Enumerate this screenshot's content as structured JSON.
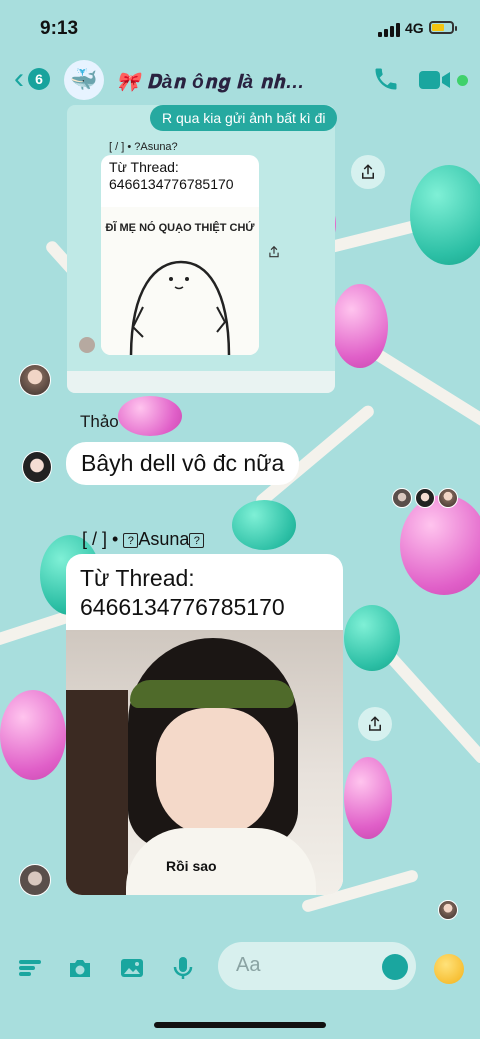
{
  "status": {
    "time": "9:13",
    "network": "4G"
  },
  "header": {
    "back_count": "6",
    "title": "🎀 𝐃à𝐧 ô𝐧𝐠 𝐥à 𝐧𝐡…",
    "group_avatar_icon": "whale-icon"
  },
  "messages": {
    "reply_text": "R qua kia gửi ảnh bất kì đi",
    "screenshot": {
      "meta": "[ / ] • ?Asuna?",
      "thread_label": "Từ Thread:",
      "thread_id": "6466134776785170",
      "meme_caption": "ĐĨ MẸ NÓ QUẠO THIỆT CHỨ"
    },
    "sender_name": "Thảo",
    "text_message": "Bâyh dell vô đc nữa",
    "post": {
      "meta_prefix": "[ / ] • ",
      "meta_name": "Asuna",
      "thread_label": "Từ Thread:",
      "thread_id": "6466134776785170",
      "photo_caption": "Rồi sao"
    }
  },
  "composer": {
    "placeholder": "Aa"
  },
  "colors": {
    "accent": "#18a39d",
    "background": "#a8dedd",
    "bubble": "#ffffff"
  }
}
